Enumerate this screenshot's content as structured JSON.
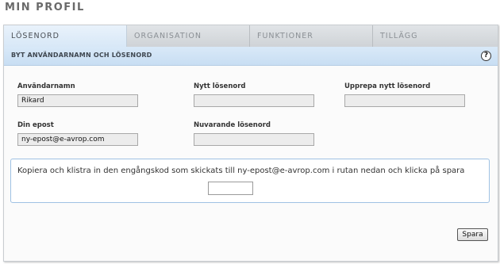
{
  "page": {
    "title": "MIN PROFIL"
  },
  "tabs": [
    {
      "label": "LÖSENORD",
      "active": true
    },
    {
      "label": "ORGANISATION",
      "active": false
    },
    {
      "label": "FUNKTIONER",
      "active": false
    },
    {
      "label": "TILLÄGG",
      "active": false
    }
  ],
  "section": {
    "title": "BYT ANVÄNDARNAMN OCH LÖSENORD",
    "help_icon": "?"
  },
  "form": {
    "username": {
      "label": "Användarnamn",
      "value": "Rikard"
    },
    "new_password": {
      "label": "Nytt lösenord",
      "value": ""
    },
    "repeat_password": {
      "label": "Upprepa nytt lösenord",
      "value": ""
    },
    "email": {
      "label": "Din epost",
      "value": "ny-epost@e-avrop.com"
    },
    "current_password": {
      "label": "Nuvarande lösenord",
      "value": ""
    }
  },
  "code_prompt": {
    "text": "Kopiera och klistra in den engångskod som skickats till ny-epost@e-avrop.com i rutan nedan och klicka på spara",
    "value": ""
  },
  "actions": {
    "save_label": "Spara"
  },
  "colors": {
    "active_tab": "#dfeefb",
    "subheader": "#d0e4f6",
    "code_box_border": "#9fc1e3",
    "input_bg": "#ececec"
  }
}
